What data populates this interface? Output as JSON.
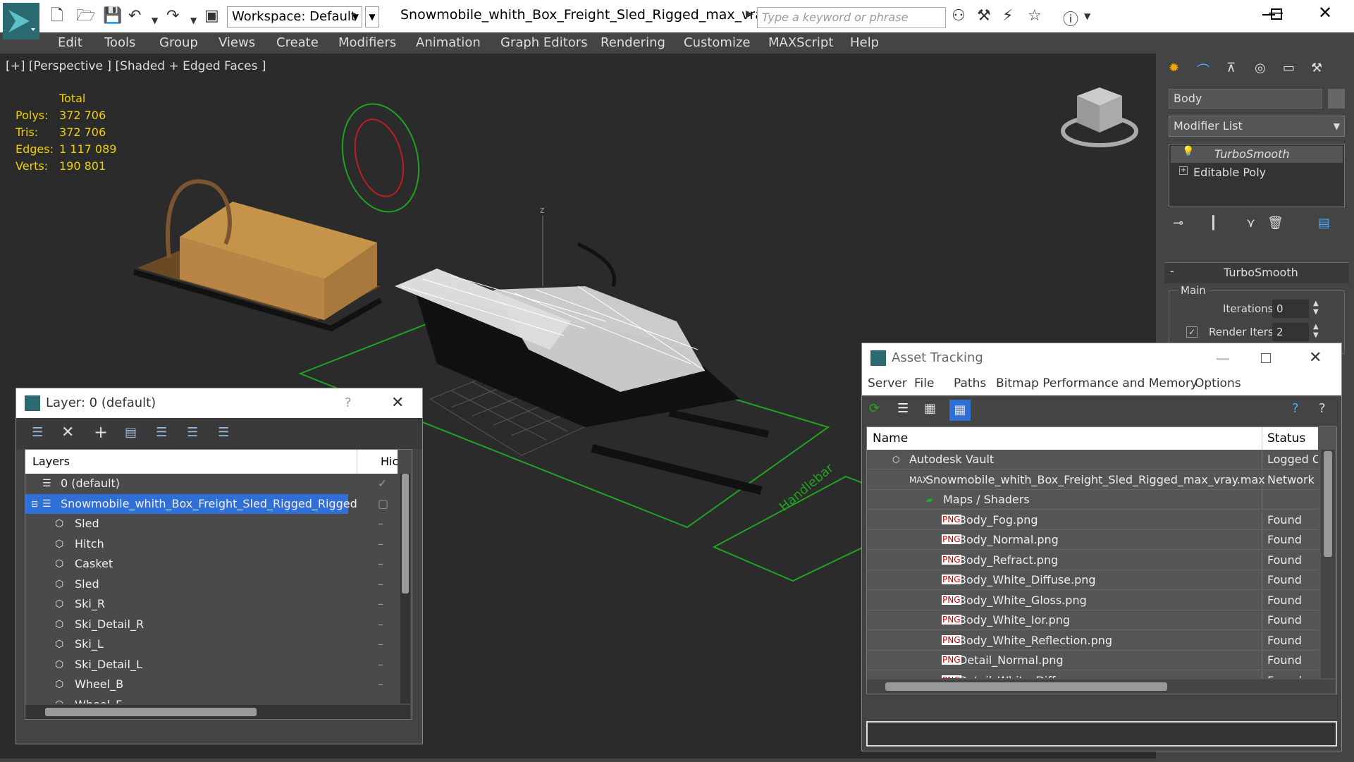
{
  "app": {
    "file_title": "Snowmobile_whith_Box_Freight_Sled_Rigged_max_vray.max",
    "workspace": "Workspace: Default",
    "search_placeholder": "Type a keyword or phrase"
  },
  "menu": [
    "Edit",
    "Tools",
    "Group",
    "Views",
    "Create",
    "Modifiers",
    "Animation",
    "Graph Editors",
    "Rendering",
    "Customize",
    "MAXScript",
    "Help"
  ],
  "viewport": {
    "label": "[+] [Perspective ] [Shaded + Edged Faces ]",
    "stats_header": "Total",
    "stats": [
      {
        "k": "Polys:",
        "v": "372 706"
      },
      {
        "k": "Tris:",
        "v": "372 706"
      },
      {
        "k": "Edges:",
        "v": "1 117 089"
      },
      {
        "k": "Verts:",
        "v": "190 801"
      }
    ],
    "axis_label": "z",
    "helper_label": "Handlebar"
  },
  "command_panel": {
    "object_name": "Body",
    "modifier_list": "Modifier List",
    "stack": [
      "TurboSmooth",
      "Editable Poly"
    ],
    "rollout_title": "TurboSmooth",
    "group_main": "Main",
    "iterations_label": "Iterations:",
    "iterations_value": "0",
    "render_iters_label": "Render Iters:",
    "render_iters_value": "2"
  },
  "layer_dialog": {
    "title": "Layer: 0 (default)",
    "help": "?",
    "col_layers": "Layers",
    "col_hide": "Hic",
    "items": [
      {
        "name": "0 (default)",
        "level": 0
      },
      {
        "name": "Snowmobile_whith_Box_Freight_Sled_Rigged_Rigged",
        "level": 0
      },
      {
        "name": "Sled",
        "level": 1
      },
      {
        "name": "Hitch",
        "level": 1
      },
      {
        "name": "Casket",
        "level": 1
      },
      {
        "name": "Sled",
        "level": 1
      },
      {
        "name": "Ski_R",
        "level": 1
      },
      {
        "name": "Ski_Detail_R",
        "level": 1
      },
      {
        "name": "Ski_L",
        "level": 1
      },
      {
        "name": "Ski_Detail_L",
        "level": 1
      },
      {
        "name": "Wheel_B",
        "level": 1
      },
      {
        "name": "Wheel_F",
        "level": 1
      }
    ]
  },
  "asset_dialog": {
    "title": "Asset Tracking",
    "menu": [
      "Server",
      "File",
      "Paths",
      "Bitmap Performance and Memory",
      "Options"
    ],
    "col_name": "Name",
    "col_status": "Status",
    "rows": [
      {
        "name": "Autodesk Vault",
        "status": "Logged Out",
        "level": 0
      },
      {
        "name": "Snowmobile_whith_Box_Freight_Sled_Rigged_max_vray.max",
        "status": "Network",
        "level": 1
      },
      {
        "name": "Maps / Shaders",
        "status": "",
        "level": 2
      },
      {
        "name": "Body_Fog.png",
        "status": "Found",
        "level": 3
      },
      {
        "name": "Body_Normal.png",
        "status": "Found",
        "level": 3
      },
      {
        "name": "Body_Refract.png",
        "status": "Found",
        "level": 3
      },
      {
        "name": "Body_White_Diffuse.png",
        "status": "Found",
        "level": 3
      },
      {
        "name": "Body_White_Gloss.png",
        "status": "Found",
        "level": 3
      },
      {
        "name": "Body_White_Ior.png",
        "status": "Found",
        "level": 3
      },
      {
        "name": "Body_White_Reflection.png",
        "status": "Found",
        "level": 3
      },
      {
        "name": "Detail_Normal.png",
        "status": "Found",
        "level": 3
      },
      {
        "name": "Detail_White_Diffuse.png",
        "status": "Found",
        "level": 3
      }
    ]
  },
  "colors": {
    "accent": "#2f6fd6",
    "yellow": "#f0d000",
    "grid": "#1fa31f"
  }
}
